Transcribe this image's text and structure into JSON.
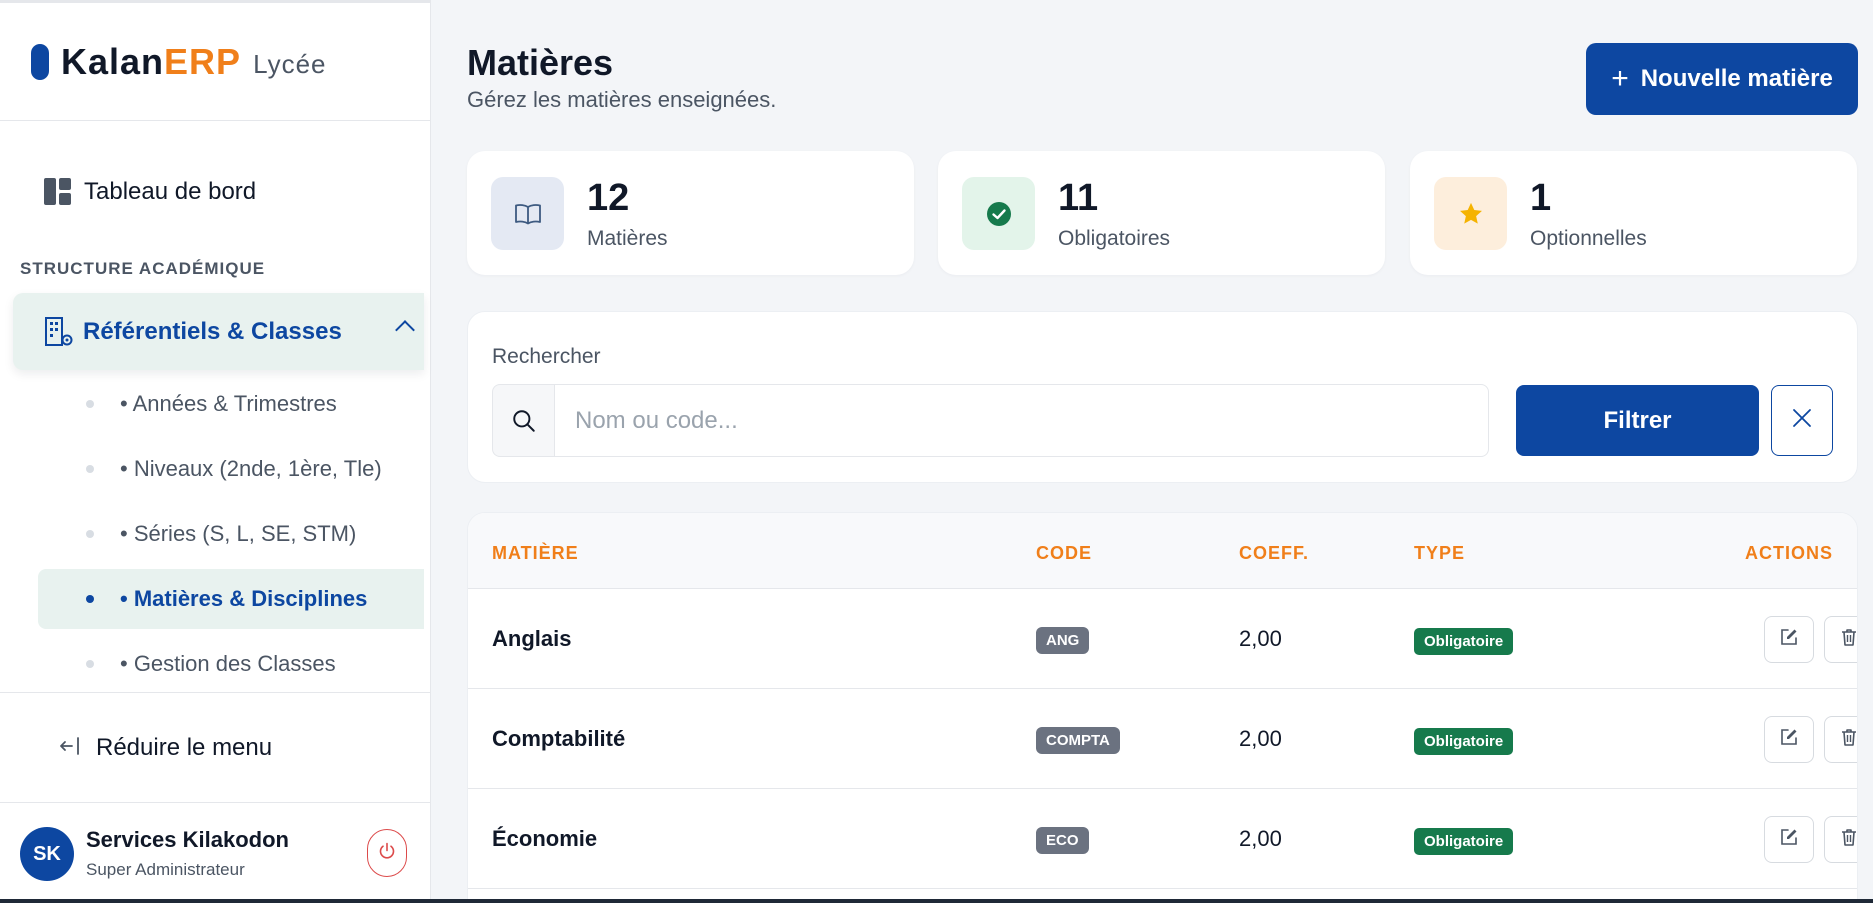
{
  "brand": {
    "name_part1": "Kalan",
    "name_part2": "ERP",
    "suffix": "Lycée"
  },
  "sidebar": {
    "dashboard_label": "Tableau de bord",
    "section_title": "STRUCTURE ACADÉMIQUE",
    "group_label": "Référentiels & Classes",
    "items": [
      {
        "label": "• Années & Trimestres",
        "active": false
      },
      {
        "label": "• Niveaux (2nde, 1ère, Tle)",
        "active": false
      },
      {
        "label": "• Séries (S, L, SE, STM)",
        "active": false
      },
      {
        "label": "• Matières & Disciplines",
        "active": true
      },
      {
        "label": "• Gestion des Classes",
        "active": false
      }
    ],
    "collapse_label": "Réduire le menu",
    "user": {
      "initials": "SK",
      "name": "Services Kilakodon",
      "role": "Super Administrateur"
    }
  },
  "header": {
    "title": "Matières",
    "subtitle": "Gérez les matières enseignées.",
    "new_button_label": "Nouvelle matière"
  },
  "stats": [
    {
      "value": "12",
      "label": "Matières",
      "icon": "book-icon"
    },
    {
      "value": "11",
      "label": "Obligatoires",
      "icon": "check-circle-icon"
    },
    {
      "value": "1",
      "label": "Optionnelles",
      "icon": "star-icon"
    }
  ],
  "filter": {
    "label": "Rechercher",
    "placeholder": "Nom ou code...",
    "value": "",
    "button_label": "Filtrer"
  },
  "table": {
    "headers": {
      "name": "MATIÈRE",
      "code": "CODE",
      "coef": "COEFF.",
      "type": "TYPE",
      "actions": "ACTIONS"
    },
    "rows": [
      {
        "name": "Anglais",
        "code": "ANG",
        "coef": "2,00",
        "type": "Obligatoire"
      },
      {
        "name": "Comptabilité",
        "code": "COMPTA",
        "coef": "2,00",
        "type": "Obligatoire"
      },
      {
        "name": "Économie",
        "code": "ECO",
        "coef": "2,00",
        "type": "Obligatoire"
      }
    ]
  },
  "colors": {
    "primary": "#0d47a1",
    "accent": "#f07f1a",
    "success": "#167a4c",
    "code_badge": "#6b7280"
  }
}
